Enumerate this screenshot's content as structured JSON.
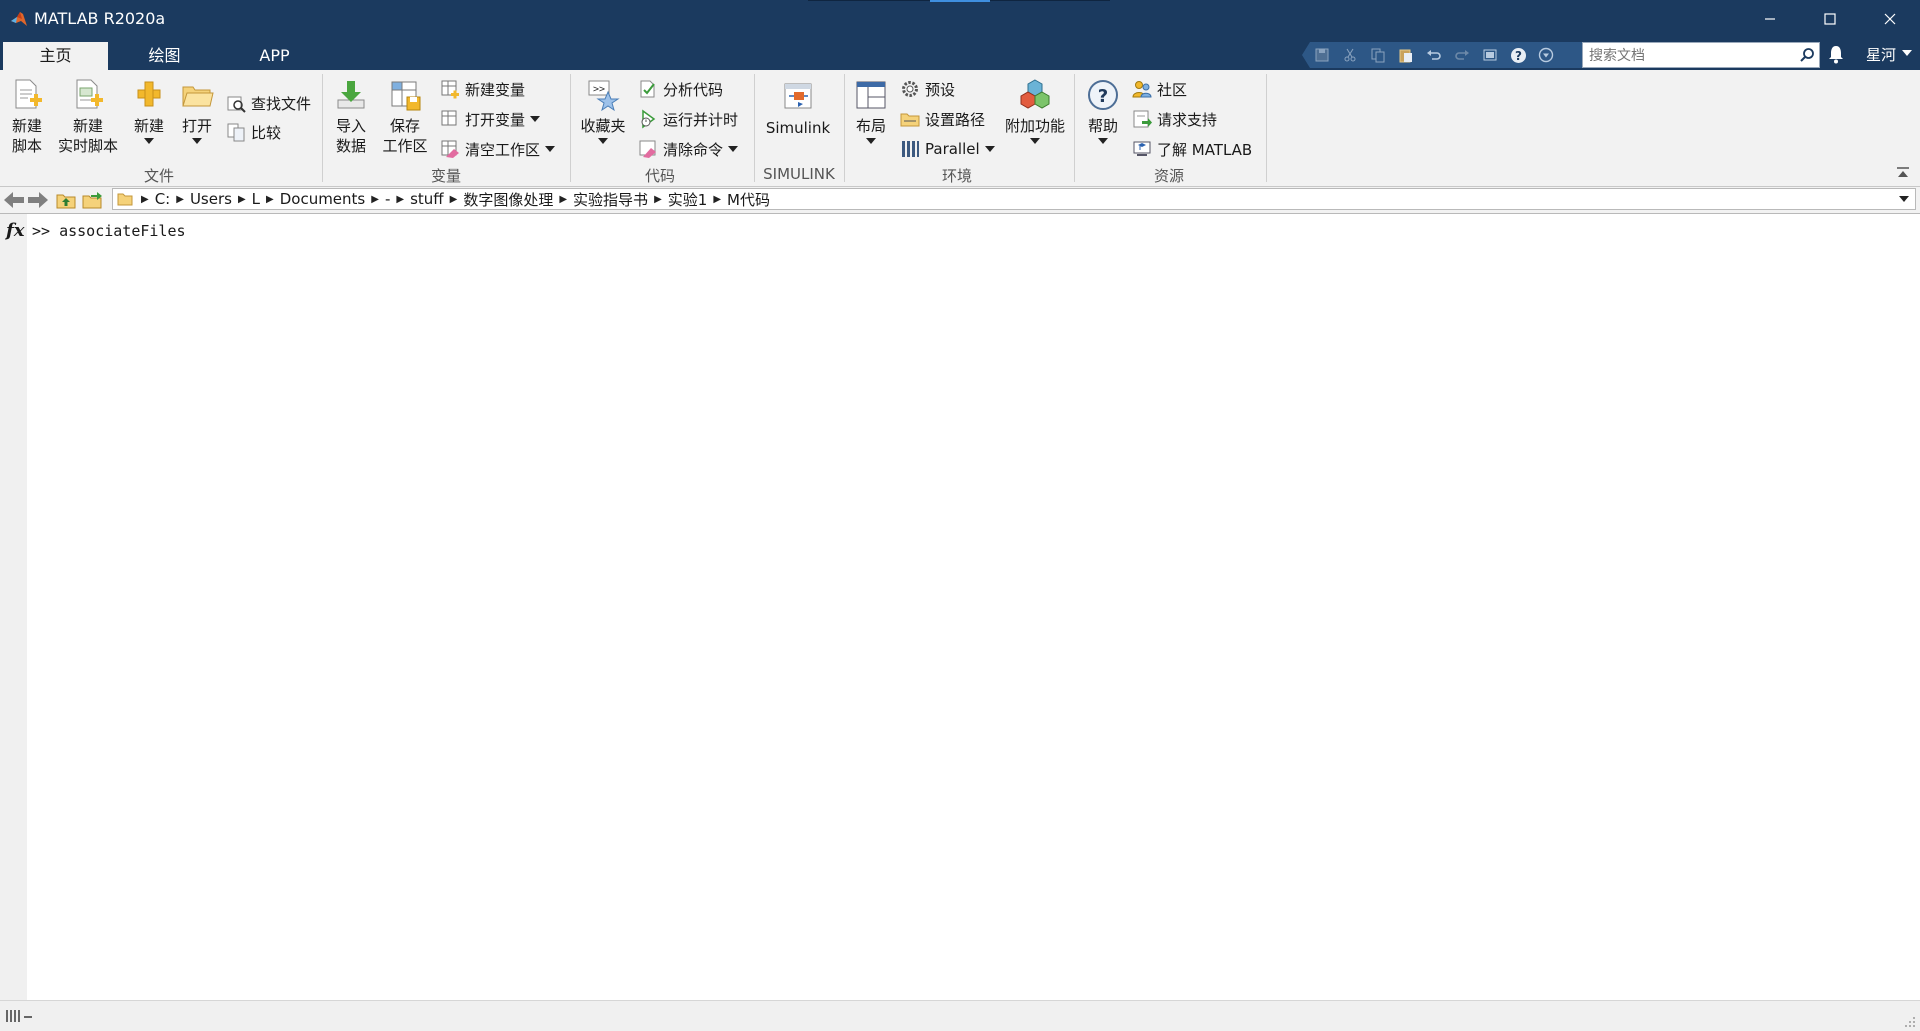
{
  "window": {
    "title": "MATLAB R2020a"
  },
  "tabs": [
    {
      "label": "主页",
      "active": true
    },
    {
      "label": "绘图",
      "active": false
    },
    {
      "label": "APP",
      "active": false
    }
  ],
  "search": {
    "placeholder": "搜索文档"
  },
  "user": {
    "name": "星河"
  },
  "ribbon": {
    "file": {
      "group_label": "文件",
      "new_script": [
        "新建",
        "脚本"
      ],
      "new_live_script": [
        "新建",
        "实时脚本"
      ],
      "new": "新建",
      "open": "打开",
      "find_files": "查找文件",
      "compare": "比较"
    },
    "variable": {
      "group_label": "变量",
      "import_data": [
        "导入",
        "数据"
      ],
      "save_workspace": [
        "保存",
        "工作区"
      ],
      "new_variable": "新建变量",
      "open_variable": "打开变量",
      "clear_workspace": "清空工作区"
    },
    "code": {
      "group_label": "代码",
      "favorites": "收藏夹",
      "analyze_code": "分析代码",
      "run_and_time": "运行并计时",
      "clear_commands": "清除命令"
    },
    "simulink": {
      "group_label": "SIMULINK",
      "simulink": "Simulink"
    },
    "environment": {
      "group_label": "环境",
      "layout": "布局",
      "preferences": "预设",
      "set_path": "设置路径",
      "parallel": "Parallel",
      "add_ons": "附加功能"
    },
    "resources": {
      "group_label": "资源",
      "help": "帮助",
      "community": "社区",
      "request_support": "请求支持",
      "learn_matlab": "了解 MATLAB"
    }
  },
  "path": {
    "crumbs": [
      "C:",
      "Users",
      "L",
      "Documents",
      "-",
      "stuff",
      "数字图像处理",
      "实验指导书",
      "实验1",
      "M代码"
    ]
  },
  "command": {
    "fx": "fx",
    "prompt": ">>",
    "text": "associateFiles"
  },
  "colors": {
    "titlebar": "#1b3a5f",
    "ribbon": "#f2f2f2",
    "accent": "#3f8fe0"
  },
  "icons": [
    "matlab-logo-icon",
    "minimize-icon",
    "maximize-icon",
    "close-icon",
    "save-icon",
    "cut-icon",
    "copy-icon",
    "paste-icon",
    "undo-icon",
    "redo-icon",
    "switch-windows-icon",
    "help-icon",
    "customize-icon",
    "search-icon",
    "bell-icon",
    "back-icon",
    "forward-icon",
    "up-folder-icon",
    "browse-folder-icon",
    "folder-icon"
  ]
}
